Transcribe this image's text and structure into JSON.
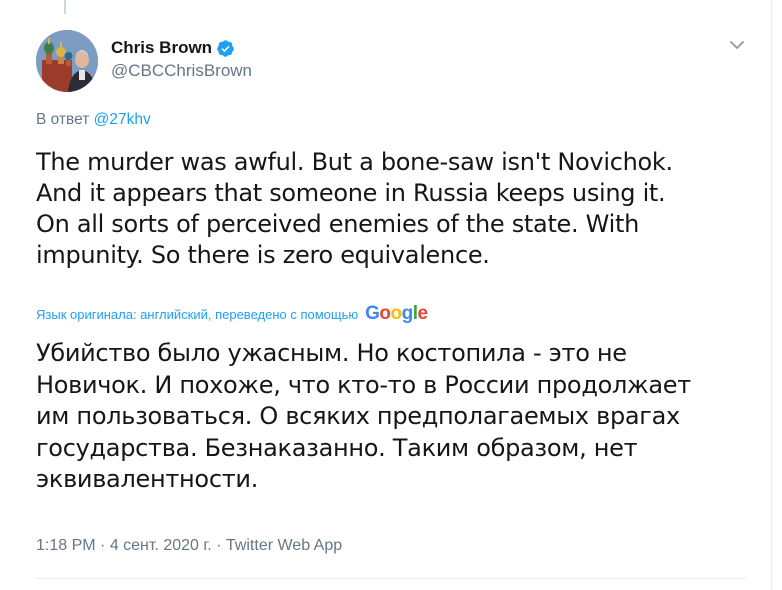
{
  "tweet": {
    "author": {
      "display_name": "Chris Brown",
      "handle": "@CBCChrisBrown",
      "verified": true
    },
    "reply_prefix": "В ответ",
    "reply_to": "@27khv",
    "text_lines": [
      "The murder was awful.  But a bone-saw isn't Novichok.",
      "And it appears that someone in Russia keeps using it.",
      "On all sorts of perceived enemies of the state.  With",
      "impunity.  So there is zero equivalence."
    ],
    "translation_note": "Язык оригинала: английский, переведено с помощью",
    "translation_provider": "Google",
    "translated_lines": [
      "Убийство было ужасным. Но костопила - это не",
      "Новичок. И похоже, что кто-то в России продолжает",
      "им пользоваться. О всяких предполагаемых врагах",
      "государства. Безнаказанно. Таким образом, нет",
      "эквивалентности."
    ],
    "time": "1:18 PM",
    "date": "4 сент. 2020 г.",
    "source": "Twitter Web App",
    "separator": " · "
  },
  "icons": {
    "verified": "verified-badge-icon",
    "caret": "chevron-down-icon"
  },
  "colors": {
    "link": "#1da1f2",
    "secondary": "#657786",
    "text": "#14171a",
    "border": "#e6ecf0"
  }
}
